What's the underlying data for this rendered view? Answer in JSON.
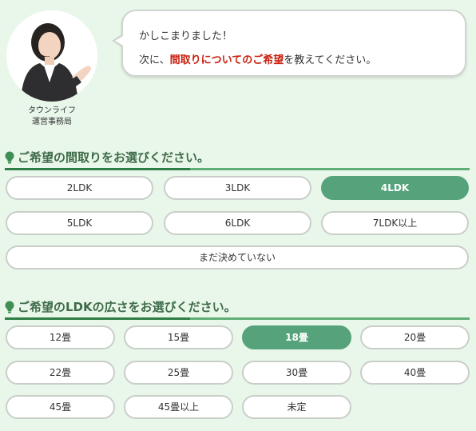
{
  "operator": {
    "name_line1": "タウンライフ",
    "name_line2": "運営事務局"
  },
  "bubble": {
    "line1": "かしこまりました！",
    "line2_prefix": "次に、",
    "line2_strong": "間取りについてのご希望",
    "line2_suffix": "を教えてください。"
  },
  "layout_section": {
    "title": "ご希望の間取りをお選びください。",
    "options": [
      {
        "label": "2LDK",
        "selected": false
      },
      {
        "label": "3LDK",
        "selected": false
      },
      {
        "label": "4LDK",
        "selected": true
      },
      {
        "label": "5LDK",
        "selected": false
      },
      {
        "label": "6LDK",
        "selected": false
      },
      {
        "label": "7LDK以上",
        "selected": false
      },
      {
        "label": "まだ決めていない",
        "selected": false
      }
    ]
  },
  "size_section": {
    "title": "ご希望のLDKの広さをお選びください。",
    "options": [
      {
        "label": "12畳",
        "selected": false
      },
      {
        "label": "15畳",
        "selected": false
      },
      {
        "label": "18畳",
        "selected": true
      },
      {
        "label": "20畳",
        "selected": false
      },
      {
        "label": "22畳",
        "selected": false
      },
      {
        "label": "25畳",
        "selected": false
      },
      {
        "label": "30畳",
        "selected": false
      },
      {
        "label": "40畳",
        "selected": false
      },
      {
        "label": "45畳",
        "selected": false
      },
      {
        "label": "45畳以上",
        "selected": false
      },
      {
        "label": "未定",
        "selected": false
      }
    ]
  },
  "colors": {
    "background": "#e9f7ea",
    "selected": "#56a37b",
    "highlight_text": "#c8200f",
    "heading": "#3f6b49"
  },
  "icons": {
    "section_icon": "lightbulb-icon"
  }
}
